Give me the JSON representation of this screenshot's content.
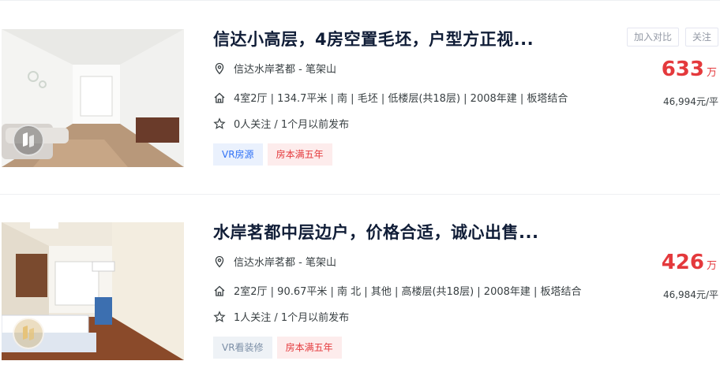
{
  "listings": [
    {
      "title": "信达小高层，4房空置毛坯，户型方正视...",
      "location_text": "信达水岸茗都 - 笔架山",
      "house_info": "4室2厅 | 134.7平米 | 南 | 毛坯 | 低楼层(共18层) | 2008年建 | 板塔结合",
      "follow_info": "0人关注 / 1个月以前发布",
      "tags": [
        "VR房源",
        "房本满五年"
      ],
      "compare_label": "加入对比",
      "follow_label": "关注",
      "total_price": "633",
      "total_price_unit": "万",
      "unit_price": "46,994元/平",
      "icons": [
        "location-pin-icon",
        "house-icon",
        "star-icon",
        "vr-icon"
      ],
      "colors": {
        "price": "#e4393c",
        "tag_vr": "#3072f6",
        "tag_five": "#e4393c"
      }
    },
    {
      "title": "水岸茗都中层边户，价格合适，诚心出售...",
      "location_text": "信达水岸茗都 - 笔架山",
      "house_info": "2室2厅 | 90.67平米 | 南 北 | 其他 | 高楼层(共18层) | 2008年建 | 板塔结合",
      "follow_info": "1人关注 / 1个月以前发布",
      "tags": [
        "VR看装修",
        "房本满五年"
      ],
      "total_price": "426",
      "total_price_unit": "万",
      "unit_price": "46,984元/平",
      "icons": [
        "location-pin-icon",
        "house-icon",
        "star-icon",
        "vr-icon"
      ]
    }
  ]
}
